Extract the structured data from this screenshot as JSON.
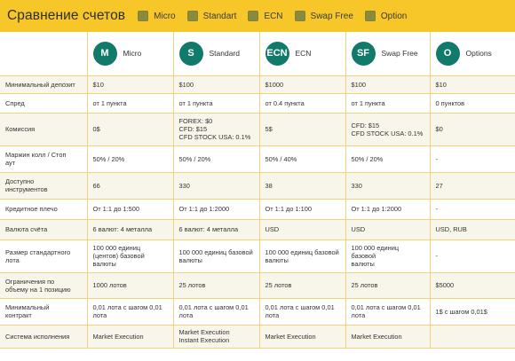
{
  "header": {
    "title": "Сравнение счетов",
    "filters": [
      {
        "label": "Micro",
        "checked": true
      },
      {
        "label": "Standart",
        "checked": true
      },
      {
        "label": "ECN",
        "checked": true
      },
      {
        "label": "Swap Free",
        "checked": true
      },
      {
        "label": "Option",
        "checked": true
      }
    ]
  },
  "accounts": [
    {
      "badge": "M",
      "name": "Micro"
    },
    {
      "badge": "S",
      "name": "Standard"
    },
    {
      "badge": "ECN",
      "name": "ECN"
    },
    {
      "badge": "SF",
      "name": "Swap Free"
    },
    {
      "badge": "O",
      "name": "Options"
    }
  ],
  "rows": [
    {
      "label": "Минимальный депозит",
      "values": [
        "$10",
        "$100",
        "$1000",
        "$100",
        "$10"
      ]
    },
    {
      "label": "Спред",
      "values": [
        "от 1 пункта",
        "от 1 пункта",
        "от 0.4 пункта",
        "от 1 пункта",
        "0 пунктов"
      ]
    },
    {
      "label": "Комиссия",
      "values": [
        "0$",
        "FOREX: $0\nCFD: $15\nCFD STOCK USA: 0.1%",
        "5$",
        "CFD: $15\nCFD STOCK USA: 0.1%",
        "$0"
      ]
    },
    {
      "label": "Маржин колл / Стоп\nаут",
      "values": [
        "50% / 20%",
        "50% / 20%",
        "50% / 40%",
        "50% / 20%",
        "-"
      ]
    },
    {
      "label": "Доступно\nинструментов",
      "values": [
        "66",
        "330",
        "38",
        "330",
        "27"
      ]
    },
    {
      "label": "Кредитное плечо",
      "values": [
        "От 1:1 до 1:500",
        "От 1:1 до 1:2000",
        "От 1:1 до 1:100",
        "От 1:1 до 1:2000",
        "-"
      ]
    },
    {
      "label": "Валюта счёта",
      "values": [
        "6 валют: 4 металла",
        "6 валют: 4 металла",
        "USD",
        "USD",
        "USD, RUB"
      ]
    },
    {
      "label": "Размер стандартного\nлота",
      "values": [
        "100 000 единиц\n(центов) базовой\nвалюты",
        "100 000 единиц базовой\nвалюты",
        "100 000 единиц базовой\nвалюты",
        "100 000 единиц базовой\nвалюты",
        "-"
      ]
    },
    {
      "label": "Ограничения по\nобъему на 1 позицию",
      "values": [
        "1000 лотов",
        "25 лотов",
        "25 лотов",
        "25 лотов",
        "$5000"
      ]
    },
    {
      "label": "Минимальный\nконтракт",
      "values": [
        "0,01 лота с шагом 0,01\nлота",
        "0,01 лота с шагом 0,01\nлота",
        "0,01 лота с шагом 0,01\nлота",
        "0,01 лота с шагом 0,01\nлота",
        "1$ с шагом 0,01$"
      ]
    },
    {
      "label": "Система исполнения",
      "values": [
        "Market Execution",
        "Market Execution\nInstant Execution",
        "Market Execution",
        "Market Execution",
        ""
      ]
    }
  ]
}
